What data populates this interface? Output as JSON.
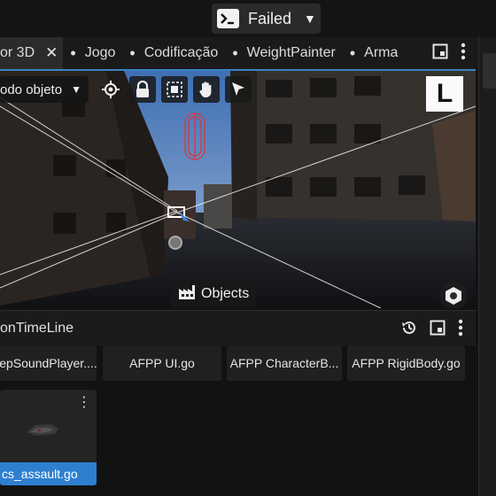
{
  "status": {
    "label": "Failed",
    "color": "#2a2a2a"
  },
  "tabs": [
    {
      "label": "or 3D",
      "active": true
    },
    {
      "label": "Jogo"
    },
    {
      "label": "Codificação"
    },
    {
      "label": "WeightPainter"
    },
    {
      "label": "Arma"
    }
  ],
  "viewport": {
    "mode_label": "odo objeto",
    "axis_badge": "L",
    "objects_label": "Objects",
    "icons": [
      "target-icon",
      "lock-icon",
      "select-group-icon",
      "hand-icon",
      "cursor-arrow-icon"
    ]
  },
  "panel": {
    "title": "onTimeLine",
    "assets": [
      "epSoundPlayer....",
      "AFPP UI.go",
      "AFPP CharacterB...",
      "AFPP RigidBody.go"
    ],
    "selected_asset": "cs_assault.go",
    "selected_color": "#2f7fd0"
  }
}
